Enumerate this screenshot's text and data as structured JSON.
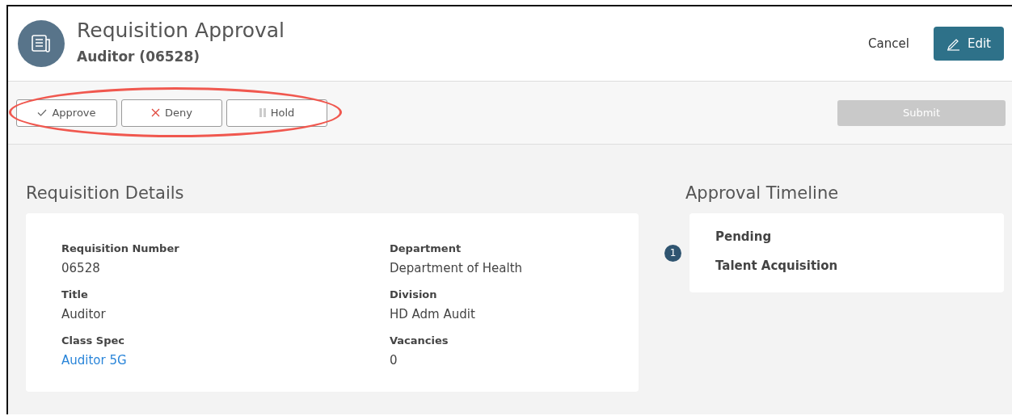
{
  "header": {
    "title": "Requisition Approval",
    "subtitle": "Auditor (06528)",
    "cancel": "Cancel",
    "edit": "Edit"
  },
  "actions": [
    {
      "kind": "approve",
      "label": "Approve"
    },
    {
      "kind": "deny",
      "label": "Deny"
    },
    {
      "kind": "hold",
      "label": "Hold"
    }
  ],
  "submit": {
    "label": "Submit",
    "disabled": true
  },
  "details": {
    "title": "Requisition Details",
    "fields": [
      {
        "label": "Requisition Number",
        "value": "06528",
        "link": false
      },
      {
        "label": "Department",
        "value": "Department of Health",
        "link": false
      },
      {
        "label": "Title",
        "value": "Auditor",
        "link": false
      },
      {
        "label": "Division",
        "value": "HD Adm Audit",
        "link": false
      },
      {
        "label": "Class Spec",
        "value": "Auditor 5G",
        "link": true
      },
      {
        "label": "Vacancies",
        "value": "0",
        "link": false
      }
    ]
  },
  "timeline": {
    "title": "Approval Timeline",
    "steps": [
      {
        "number": "1",
        "status": "Pending",
        "approver": "Talent Acquisition"
      }
    ]
  }
}
